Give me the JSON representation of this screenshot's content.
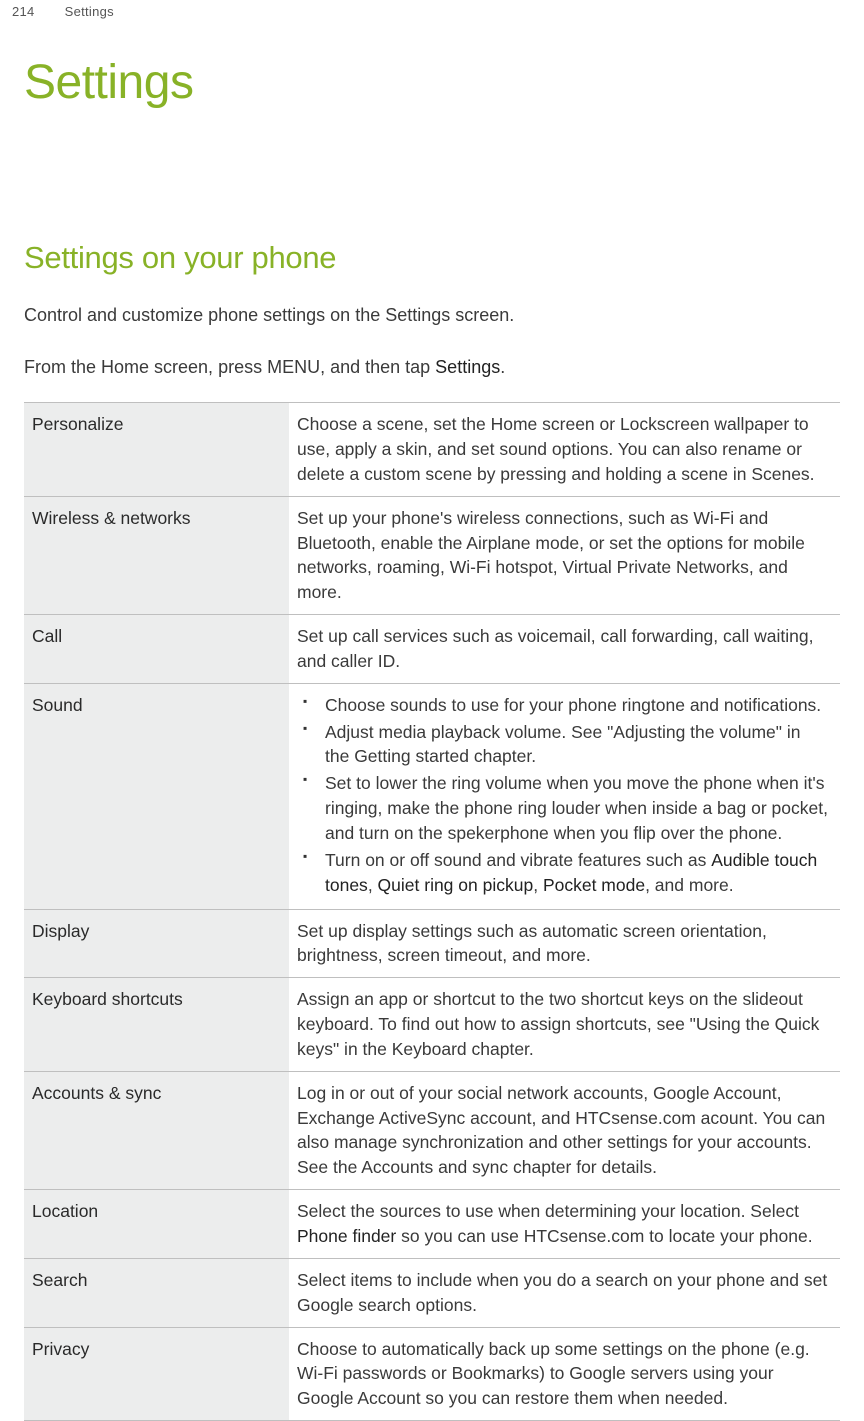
{
  "header": {
    "page_number": "214",
    "section": "Settings"
  },
  "title": "Settings",
  "subheading": "Settings on your phone",
  "intro1": "Control and customize phone settings on the Settings screen.",
  "intro2_prefix": "From the Home screen, press MENU, and then tap ",
  "intro2_bold": "Settings",
  "intro2_suffix": ".",
  "rows": {
    "personalize": {
      "label": "Personalize",
      "desc": "Choose a scene, set the Home screen or Lockscreen wallpaper to use, apply a skin, and set sound options. You can also rename or delete a custom scene by pressing and holding a scene in Scenes."
    },
    "wireless": {
      "label": "Wireless & networks",
      "desc": "Set up your phone's wireless connections, such as Wi-Fi and Bluetooth, enable the Airplane mode, or set the options for mobile networks, roaming, Wi-Fi hotspot, Virtual Private Networks, and more."
    },
    "call": {
      "label": "Call",
      "desc": "Set up call services such as voicemail, call forwarding, call waiting, and caller ID."
    },
    "sound": {
      "label": "Sound",
      "b1": "Choose sounds to use for your phone ringtone and notifications.",
      "b2": "Adjust media playback volume. See \"Adjusting the volume\" in the Getting started chapter.",
      "b3": "Set to lower the ring volume when you move the phone when it's ringing, make the phone ring louder when inside a bag or pocket, and turn on the spekerphone when you flip over the phone.",
      "b4_prefix": "Turn on or off sound and vibrate features such as ",
      "b4_bold1": "Audible touch tones",
      "b4_sep1": ", ",
      "b4_bold2": "Quiet ring on pickup",
      "b4_sep2": ", ",
      "b4_bold3": "Pocket mode",
      "b4_suffix": ", and more."
    },
    "display": {
      "label": "Display",
      "desc": "Set up display settings such as automatic screen orientation, brightness, screen timeout, and more."
    },
    "keyboard": {
      "label": "Keyboard shortcuts",
      "desc": "Assign an app or shortcut to the two shortcut keys on the slideout keyboard. To find out how to assign shortcuts, see \"Using the Quick keys\" in the Keyboard chapter."
    },
    "accounts": {
      "label": "Accounts & sync",
      "desc": "Log in or out of your social network accounts, Google Account, Exchange ActiveSync account, and HTCsense.com acount. You can also manage synchronization and other settings for your accounts. See the Accounts and sync chapter for details."
    },
    "location": {
      "label": "Location",
      "desc_prefix": "Select the sources to use when determining your location. Select ",
      "desc_bold": "Phone finder",
      "desc_suffix": " so you can use HTCsense.com to locate your phone."
    },
    "search": {
      "label": "Search",
      "desc": "Select items to include when you do a search on your phone and set Google search options."
    },
    "privacy": {
      "label": "Privacy",
      "desc": "Choose to automatically back up some settings on the phone (e.g. Wi-Fi passwords or Bookmarks) to Google servers using your Google Account so you can restore them when needed."
    }
  }
}
